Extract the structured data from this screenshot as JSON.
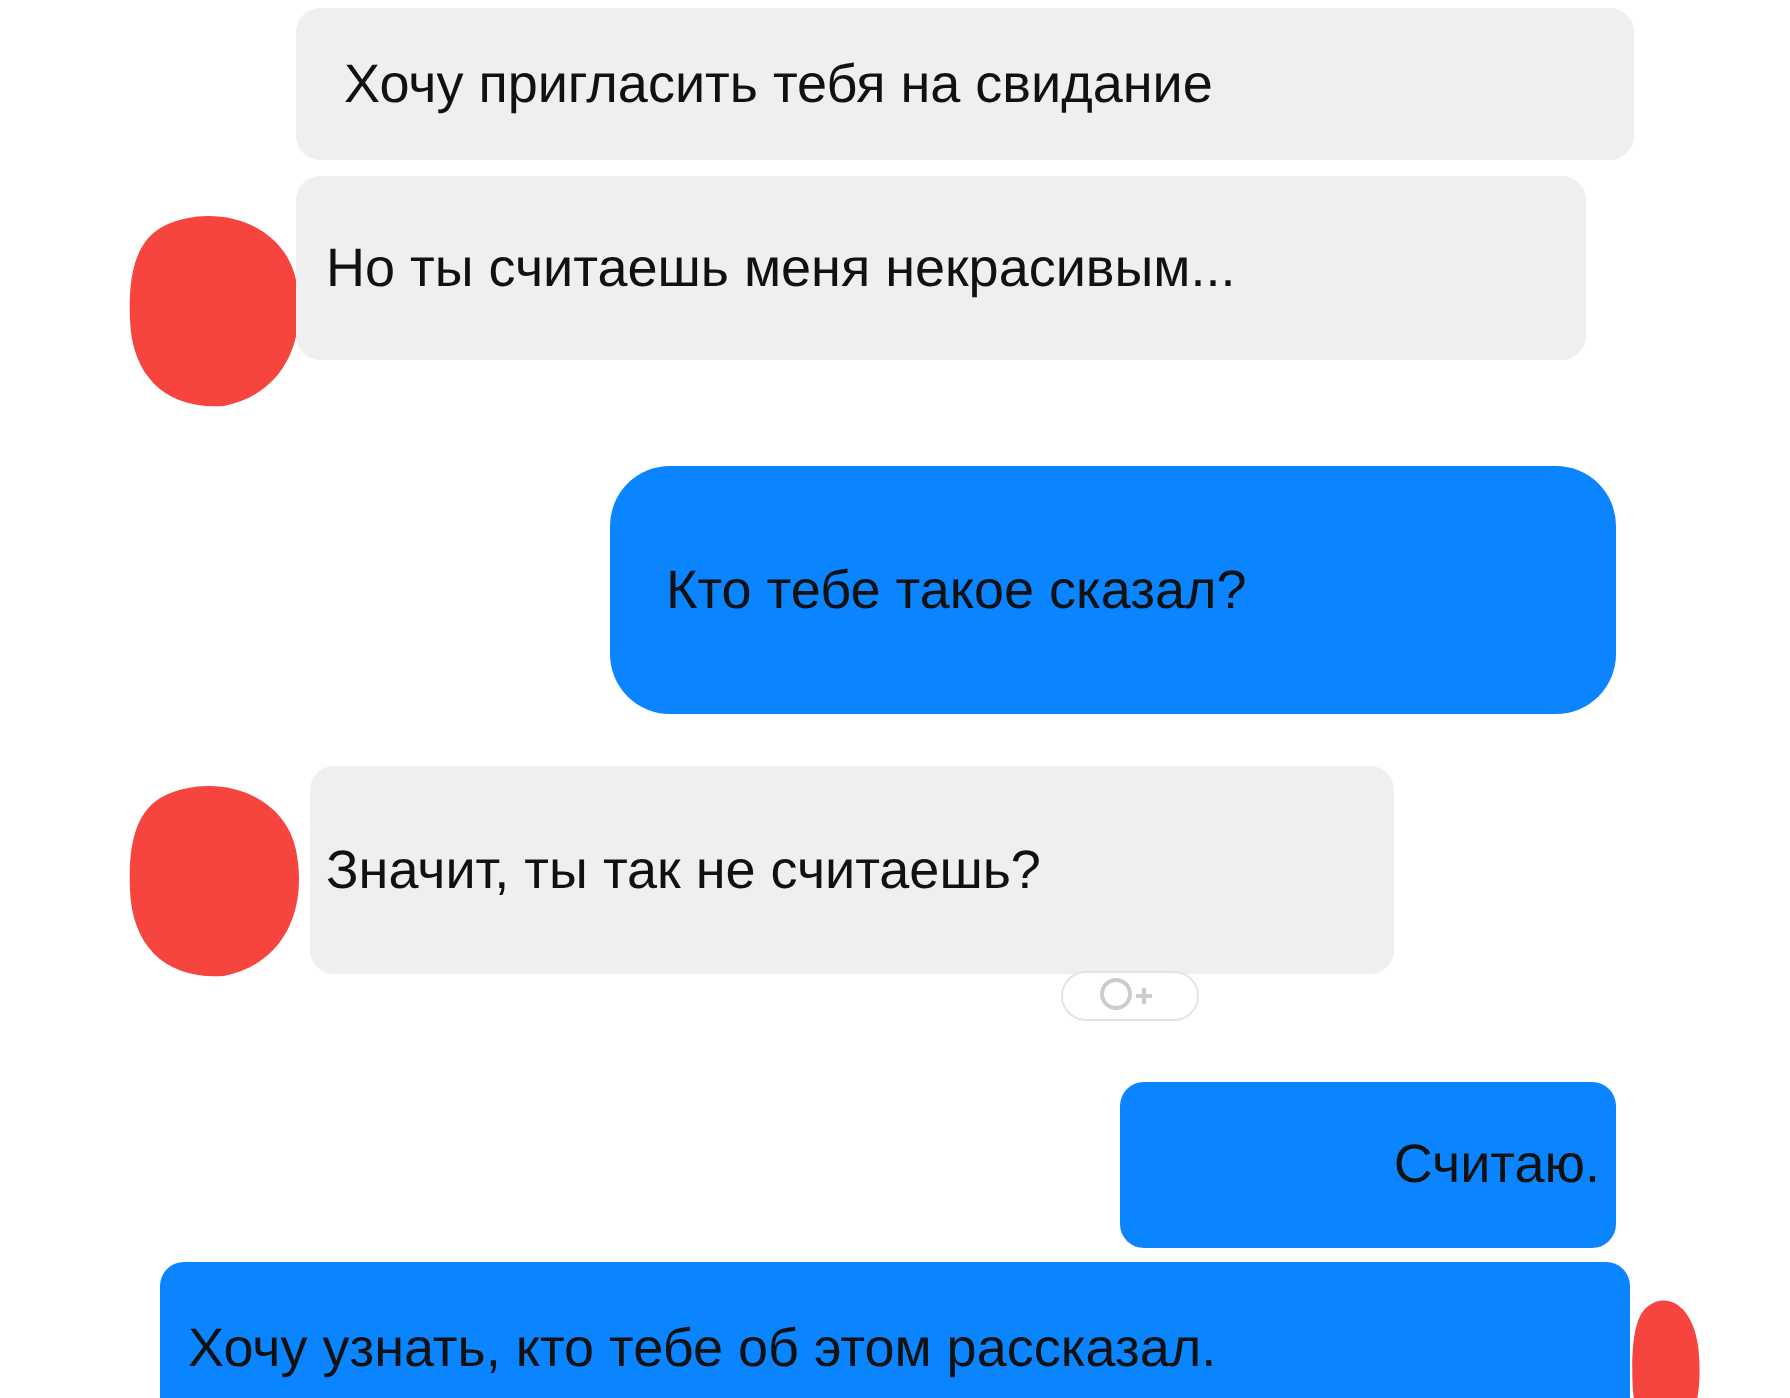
{
  "messages": [
    {
      "kind": "incoming",
      "text": "Хочу пригласить тебя на свидание",
      "avatar": false,
      "reaction": false
    },
    {
      "kind": "incoming",
      "text": "Но ты считаешь меня некрасивым...",
      "avatar": true,
      "reaction": false
    },
    {
      "kind": "outgoing",
      "text": "Кто тебе такое сказал?",
      "avatar": false,
      "reaction": false
    },
    {
      "kind": "incoming",
      "text": "Значит, ты так не считаешь?",
      "avatar": true,
      "reaction": true
    },
    {
      "kind": "outgoing",
      "text": "Считаю.",
      "avatar": false,
      "reaction": false
    },
    {
      "kind": "outgoing",
      "text": "Хочу узнать, кто тебе об этом рассказал.",
      "avatar": true,
      "reaction": false
    }
  ]
}
